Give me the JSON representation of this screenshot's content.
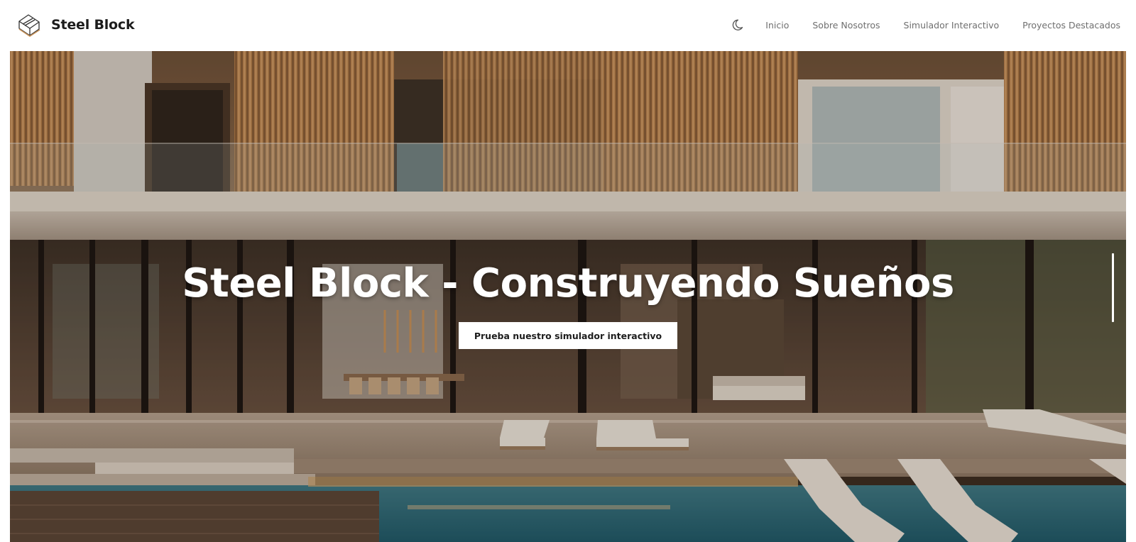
{
  "brand": {
    "name": "Steel Block",
    "logo_icon": "house-wireframe-icon"
  },
  "nav": {
    "theme_toggle_icon": "moon-icon",
    "links": [
      "Inicio",
      "Sobre Nosotros",
      "Simulador Interactivo",
      "Proyectos Destacados"
    ]
  },
  "hero": {
    "title": "Steel Block - Construyendo Sueños",
    "cta_label": "Prueba nuestro simulador interactivo",
    "background": "modern-house-with-pool-photo"
  },
  "colors": {
    "text_dark": "#1c1c1c",
    "nav_text": "#6f6f6f",
    "hero_text": "#ffffff",
    "accent_wood": "#c8935a"
  }
}
